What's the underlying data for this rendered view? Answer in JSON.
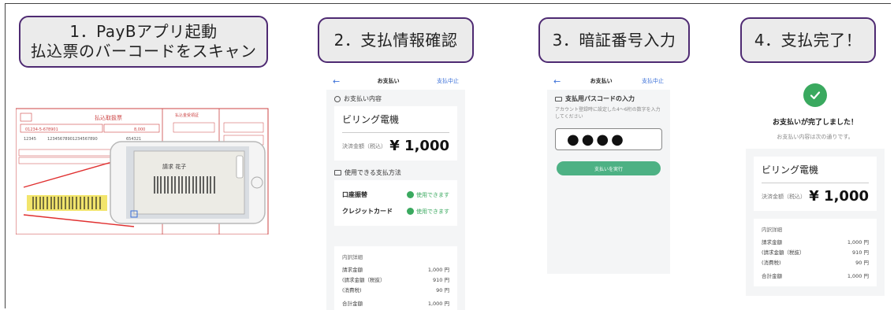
{
  "steps": [
    {
      "line1": "1．PayBアプリ起動",
      "line2": "払込票のバーコードをスキャン"
    },
    {
      "line1": "2．支払情報確認"
    },
    {
      "line1": "3．暗証番号入力"
    },
    {
      "line1": "4．支払完了！"
    }
  ],
  "screen2": {
    "header_title": "お支払い",
    "header_cancel": "支払中止",
    "section_info": "お支払い内容",
    "shop_name": "ビリング電機",
    "amount_label": "決済金額（税込）",
    "amount": "¥ 1,000",
    "section_methods": "使用できる支払方法",
    "methods": [
      {
        "name": "口座振替",
        "status": "使用できます"
      },
      {
        "name": "クレジットカード",
        "status": "使用できます"
      }
    ],
    "detail_title": "内訳詳細",
    "details": [
      {
        "label": "請求金額",
        "value": "1,000 円"
      },
      {
        "label": "(請求金額（税抜）",
        "value": "910 円"
      },
      {
        "label": "(消費税)",
        "value": "90 円"
      },
      {
        "label": "合計金額",
        "value": "1,000 円"
      }
    ]
  },
  "screen3": {
    "header_title": "お支払い",
    "header_cancel": "支払中止",
    "section_title": "支払用パスコードの入力",
    "note": "アカウント登録時に設定した4〜6桁の数字を入力してください",
    "pin_mask": "●●●●",
    "button": "支払いを実行"
  },
  "screen4": {
    "complete_title": "お支払いが完了しました！",
    "complete_sub": "お支払い内容は次の通りです。",
    "shop_name": "ビリング電機",
    "amount_label": "決済金額（税込）",
    "amount": "¥ 1,000",
    "detail_title": "内訳詳細",
    "details": [
      {
        "label": "請求金額",
        "value": "1,000 円"
      },
      {
        "label": "(請求金額（税抜）",
        "value": "910 円"
      },
      {
        "label": "(消費税)",
        "value": "90 円"
      },
      {
        "label": "合計金額",
        "value": "1,000 円"
      }
    ]
  },
  "scan": {
    "slip_title": "払込取扱票",
    "slip_receipt": "払込金受領証",
    "account_no": "01234-5-678901",
    "amount": "8,000",
    "name": "請求 花子",
    "numbers_a": "12345",
    "numbers_b": "12345678901234567890",
    "numbers_c": "654321"
  },
  "colors": {
    "step_border": "#4e2a72",
    "green": "#3aa95f",
    "link": "#3a6fd8"
  }
}
